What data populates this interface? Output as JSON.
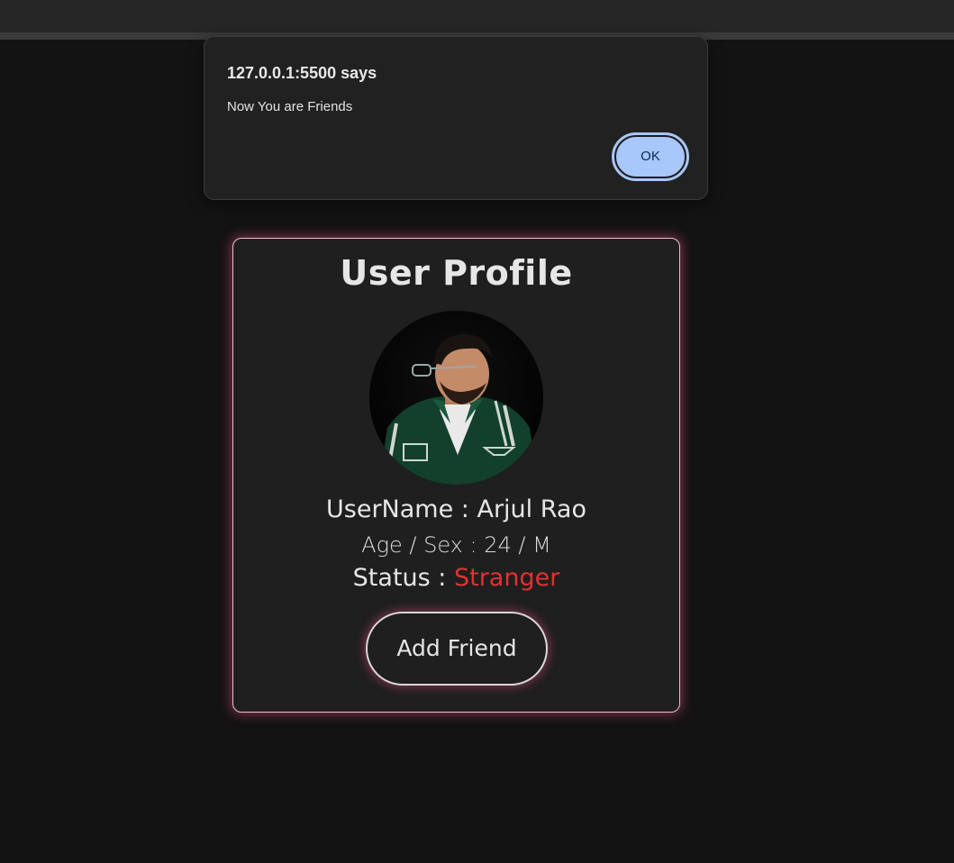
{
  "dialog": {
    "title": "127.0.0.1:5500 says",
    "message": "Now You are Friends",
    "ok_label": "OK"
  },
  "profile": {
    "title": "User Profile",
    "username_text": "UserName : Arjul Rao",
    "agesex_text": "Age / Sex : 24 / M",
    "status_label": "Status : ",
    "status_value": "Stranger",
    "add_friend_label": "Add Friend"
  },
  "colors": {
    "status_stranger": "#e0322f",
    "card_glow": "#d64878",
    "ok_button": "#a8c7fa"
  },
  "icons": {
    "avatar": "user-photo"
  }
}
